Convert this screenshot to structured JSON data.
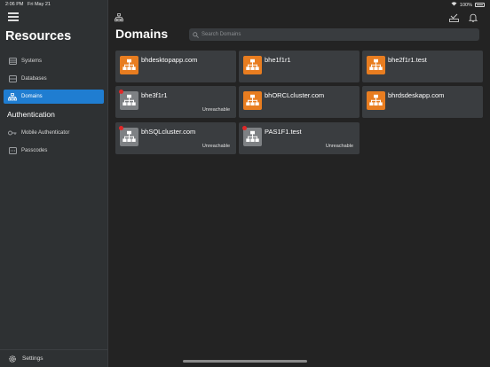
{
  "status_bar": {
    "time": "2:06 PM",
    "date": "Fri May 21",
    "battery": "100%"
  },
  "sidebar": {
    "title": "Resources",
    "items": [
      {
        "label": "Systems",
        "icon": "systems-icon"
      },
      {
        "label": "Databases",
        "icon": "databases-icon"
      },
      {
        "label": "Domains",
        "icon": "domains-icon",
        "active": true
      }
    ],
    "section2_title": "Authentication",
    "auth_items": [
      {
        "label": "Mobile Authenticator",
        "icon": "key-icon"
      },
      {
        "label": "Passcodes",
        "icon": "passcodes-icon"
      }
    ],
    "settings_label": "Settings"
  },
  "main": {
    "title": "Domains",
    "search_placeholder": "Search Domains",
    "domains": [
      {
        "name": "bhdesktopapp.com",
        "status": "",
        "color": "#e87d20"
      },
      {
        "name": "bhe1f1r1",
        "status": "",
        "color": "#e87d20"
      },
      {
        "name": "bhe2f1r1.test",
        "status": "",
        "color": "#e87d20"
      },
      {
        "name": "bhe3f1r1",
        "status": "Unreachable",
        "color": "#7e8184"
      },
      {
        "name": "bhORCLcluster.com",
        "status": "",
        "color": "#e87d20"
      },
      {
        "name": "bhrdsdeskapp.com",
        "status": "",
        "color": "#e87d20"
      },
      {
        "name": "bhSQLcluster.com",
        "status": "Unreachable",
        "color": "#7e8184"
      },
      {
        "name": "PAS1F1.test",
        "status": "Unreachable",
        "color": "#7e8184"
      }
    ]
  }
}
